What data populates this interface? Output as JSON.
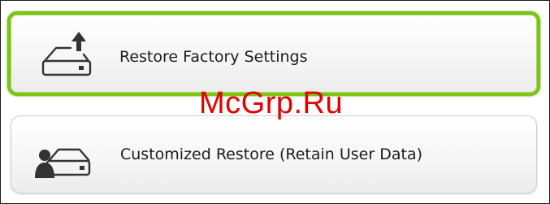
{
  "options": [
    {
      "label": "Restore Factory Settings",
      "icon": "drive-upload-icon",
      "selected": true
    },
    {
      "label": "Customized Restore (Retain User Data)",
      "icon": "drive-user-icon",
      "selected": false
    }
  ],
  "watermark": "McGrp.Ru",
  "colors": {
    "selection_border": "#7cc314",
    "watermark": "#e00000",
    "icon": "#333333"
  }
}
